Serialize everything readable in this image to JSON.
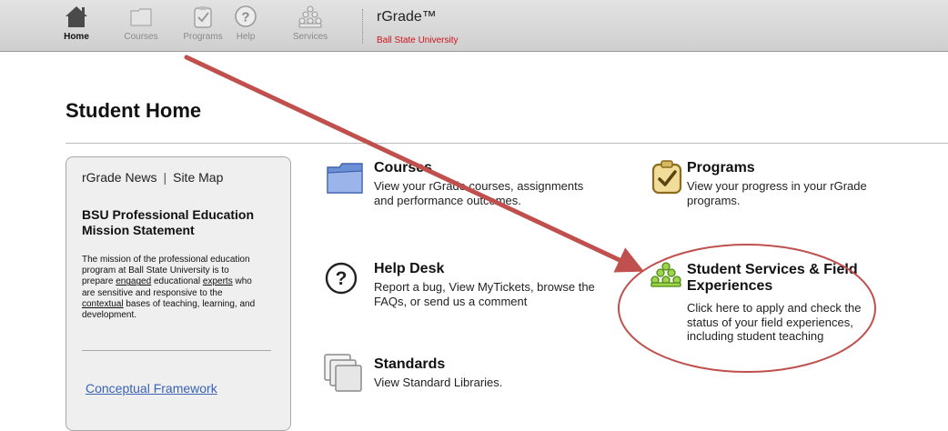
{
  "toolbar": {
    "items": [
      {
        "label": "Home",
        "icon": "home-icon"
      },
      {
        "label": "Courses",
        "icon": "folder-icon"
      },
      {
        "label": "Programs",
        "icon": "clipboard-check-icon"
      },
      {
        "label": "Help",
        "icon": "question-icon"
      },
      {
        "label": "Services",
        "icon": "people-group-icon"
      }
    ],
    "brand_title": "rGrade™",
    "brand_subtitle": "Ball State University"
  },
  "page": {
    "title": "Student Home"
  },
  "sidebar": {
    "links": [
      "rGrade News",
      "Site Map"
    ],
    "mission_title": "BSU Professional Education Mission Statement",
    "mission_text": {
      "p1": "The mission of the professional education program at Ball State University is to prepare ",
      "u1": "engaged",
      "p2": " educational ",
      "u2": "experts",
      "p3": " who are sensitive and responsive to the ",
      "u3": "contextual",
      "p4": " bases of teaching, learning, and development."
    },
    "framework_link": "Conceptual Framework"
  },
  "tiles": {
    "courses": {
      "title": "Courses",
      "desc": "View your rGrade courses, assignments and performance outcomes."
    },
    "programs": {
      "title": "Programs",
      "desc": "View your progress in your rGrade programs."
    },
    "help": {
      "title": "Help Desk",
      "desc": "Report a bug, View MyTickets, browse the FAQs, or send us a comment"
    },
    "services": {
      "title": "Student Services & Field Experiences",
      "desc": "Click here to apply and check the status of your field experiences, including student teaching"
    },
    "standards": {
      "title": "Standards",
      "desc": "View Standard Libraries."
    }
  },
  "colors": {
    "annotation": "#c0504d",
    "brand_red": "#d0121b",
    "link_blue": "#3a63b5",
    "services_green": "#8cc63f"
  }
}
